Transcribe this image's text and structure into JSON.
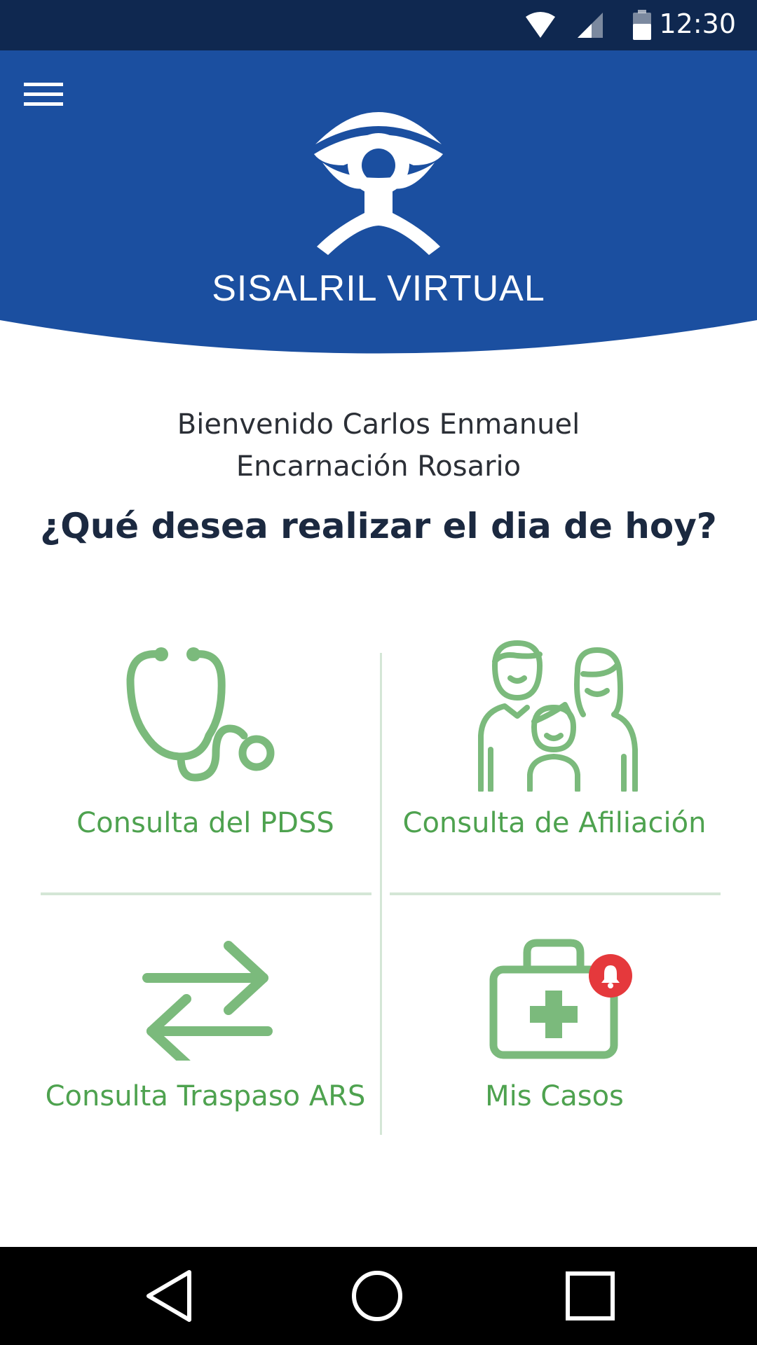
{
  "status_bar": {
    "time": "12:30",
    "icons": [
      "wifi-icon",
      "signal-icon",
      "battery-icon"
    ]
  },
  "header": {
    "title": "SISALRIL VIRTUAL",
    "menu_icon": "hamburger-menu-icon",
    "logo": "sisalril-logo",
    "color": "#1b4fa0"
  },
  "welcome": {
    "line1": "Bienvenido Carlos Enmanuel",
    "line2": "Encarnación Rosario"
  },
  "question": "¿Qué desea realizar el dia de hoy?",
  "tiles": [
    {
      "label": "Consulta del PDSS",
      "icon": "stethoscope-icon"
    },
    {
      "label": "Consulta de Afiliación",
      "icon": "family-icon"
    },
    {
      "label": "Consulta Traspaso ARS",
      "icon": "transfer-arrows-icon"
    },
    {
      "label": "Mis Casos",
      "icon": "medical-kit-icon",
      "badge_icon": "bell-notification-icon"
    }
  ],
  "colors": {
    "accent_green": "#4ea24f",
    "icon_green": "#7bba7c",
    "badge_red": "#e5393c",
    "status_bar": "#0f2850"
  },
  "nav_bar": {
    "icons": [
      "back-icon",
      "home-icon",
      "recents-icon"
    ]
  }
}
